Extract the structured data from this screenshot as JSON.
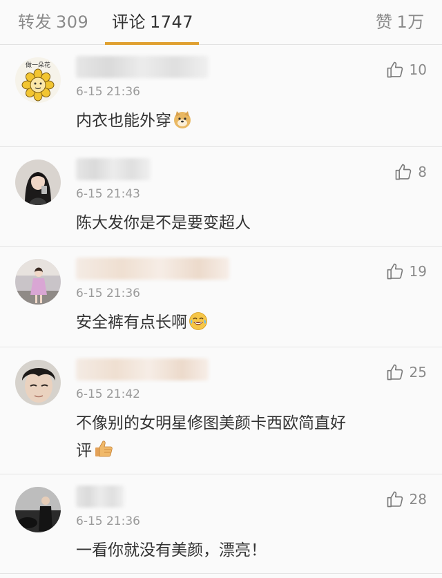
{
  "tabs": [
    {
      "label": "转发",
      "count": "309"
    },
    {
      "label": "评论",
      "count": "1747"
    },
    {
      "label": "赞",
      "count": "1万"
    }
  ],
  "comments": [
    {
      "time": "6-15 21:36",
      "text": "内衣也能外穿",
      "likes": "10",
      "emoji": "doge-emoji"
    },
    {
      "time": "6-15 21:43",
      "text": "陈大发你是不是要变超人",
      "likes": "8"
    },
    {
      "time": "6-15 21:36",
      "text": "安全裤有点长啊",
      "likes": "19",
      "emoji": "laugh-cry-emoji"
    },
    {
      "time": "6-15 21:42",
      "text": "不像别的女明星修图美颜卡西欧简直好",
      "text2": "评",
      "likes": "25",
      "emoji": "thumbs-up-emoji"
    },
    {
      "time": "6-15 21:36",
      "text": "一看你就没有美颜，漂亮！",
      "likes": "28"
    }
  ],
  "avatar_badge_text": "做一朵花",
  "colors": {
    "accent": "#e0a030",
    "time": "#9a9a9a",
    "like": "#8a8a8a",
    "text": "#333333"
  }
}
